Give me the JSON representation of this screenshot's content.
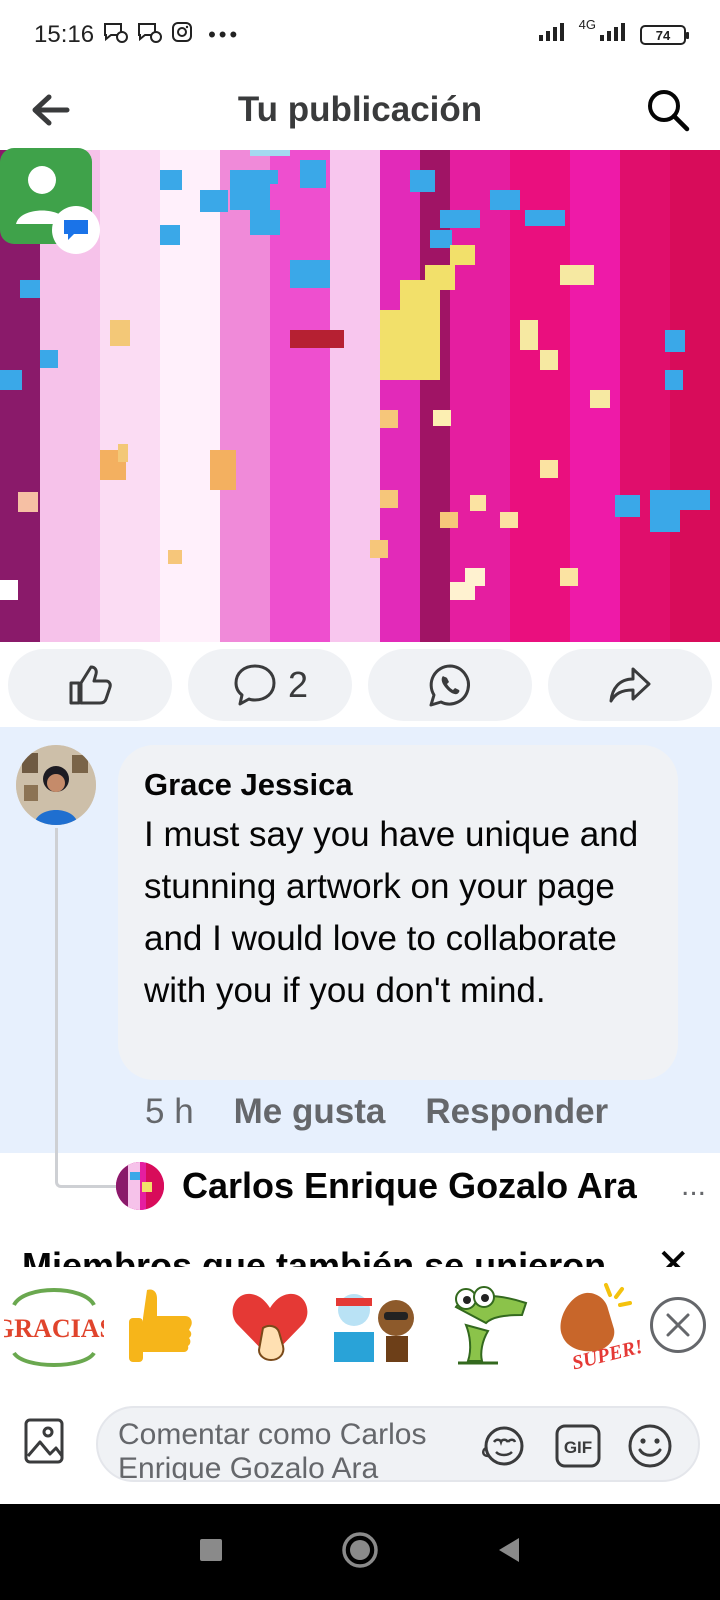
{
  "status_bar": {
    "time": "15:16",
    "network": "4G",
    "battery": "74"
  },
  "header": {
    "title": "Tu publicación"
  },
  "actions": {
    "comment_count": "2"
  },
  "comment": {
    "author": "Grace Jessica",
    "text": "I must say you have unique and stunning artwork on your page and I would love to collaborate with you if you don't mind.",
    "time": "5 h",
    "like_label": "Me gusta",
    "reply_label": "Responder"
  },
  "reply": {
    "author": "Carlos Enrique Gozalo Ara",
    "more": "..."
  },
  "members": {
    "title": "Miembros que también se unieron"
  },
  "stickers": [
    {
      "name": "gracias-sticker",
      "text": "GRACIAS"
    },
    {
      "name": "thumbs-up-sticker",
      "text": ""
    },
    {
      "name": "heart-hand-sticker",
      "text": ""
    },
    {
      "name": "dj-characters-sticker",
      "text": ""
    },
    {
      "name": "crocodile-sticker",
      "text": ""
    },
    {
      "name": "super-clap-sticker",
      "text": "SUPER!"
    }
  ],
  "composer": {
    "placeholder": "Comentar como Carlos Enrique Gozalo Ara",
    "gif_label": "GIF"
  },
  "colors": {
    "accent": "#1877f2",
    "comment_highlight": "#e7f0fd",
    "bubble": "#f0f2f5",
    "muted": "#65676b"
  }
}
